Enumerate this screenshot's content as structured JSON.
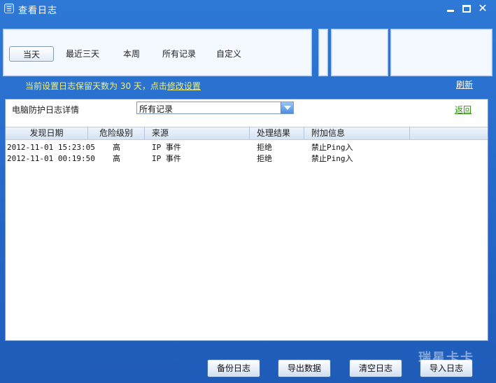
{
  "window": {
    "title": "查看日志",
    "icons": [
      "app-icon",
      "minimize-icon",
      "maximize-icon",
      "close-icon"
    ],
    "close_glyph": "✕"
  },
  "tabs": [
    {
      "label": "当天",
      "active": true
    },
    {
      "label": "最近三天",
      "active": false
    },
    {
      "label": "本周",
      "active": false
    },
    {
      "label": "所有记录",
      "active": false
    },
    {
      "label": "自定义",
      "active": false
    }
  ],
  "notice": {
    "text": "当前设置日志保留天数为 30 天，点击",
    "link": "修改设置"
  },
  "refresh_label": "刷新",
  "detail": {
    "label": "电脑防护日志详情",
    "filter_value": "所有记录",
    "back_label": "返回"
  },
  "table": {
    "columns": [
      "发现日期",
      "危险级别",
      "来源",
      "处理结果",
      "附加信息",
      ""
    ],
    "rows": [
      {
        "date": "2012-11-01 15:23:05",
        "level": "高",
        "source": "IP 事件",
        "result": "拒绝",
        "info": "禁止Ping入"
      },
      {
        "date": "2012-11-01 00:19:50",
        "level": "高",
        "source": "IP 事件",
        "result": "拒绝",
        "info": "禁止Ping入"
      }
    ]
  },
  "buttons": [
    "备份日志",
    "导出数据",
    "清空日志",
    "导入日志"
  ],
  "watermark": "瑞星卡卡",
  "colors": {
    "window_blue": "#2466c6",
    "notice_yellow": "#f4f074",
    "back_green": "#2f8a12"
  }
}
